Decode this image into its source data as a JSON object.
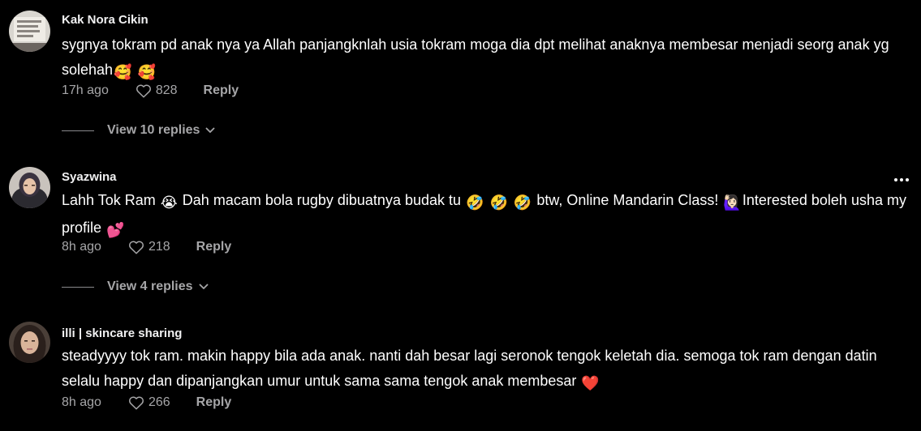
{
  "comments": [
    {
      "username": "Kak Nora Cikin",
      "text_parts": [
        "sygnya tokram pd anak nya ya Allah panjangknlah usia tokram moga dia dpt melihat anaknya membesar menjadi seorg anak yg solehah",
        "🥰",
        " ",
        "🥰"
      ],
      "time": "17h ago",
      "likes": "828",
      "reply_label": "Reply",
      "view_replies": "View 10 replies"
    },
    {
      "username": "Syazwina",
      "text_parts": [
        "Lahh Tok Ram ",
        "😭",
        " Dah macam bola rugby dibuatnya budak tu ",
        "🤣",
        " ",
        "🤣",
        " ",
        "🤣",
        " btw, Online Mandarin Class! ",
        "🙋🏻‍♀️",
        "Interested boleh usha my profile ",
        "💕"
      ],
      "time": "8h ago",
      "likes": "218",
      "reply_label": "Reply",
      "view_replies": "View 4 replies",
      "more_icon": "more-horizontal-icon"
    },
    {
      "username": "illi | skincare sharing",
      "text_parts": [
        "steadyyyy tok ram. makin happy bila ada anak. nanti dah besar lagi seronok tengok keletah dia. semoga tok ram dengan datin selalu happy dan dipanjangkan umur untuk sama sama tengok anak membesar ",
        "❤️"
      ],
      "time": "8h ago",
      "likes": "266",
      "reply_label": "Reply"
    }
  ],
  "icons": {
    "like": "heart-outline-icon",
    "expand": "chevron-down-icon"
  },
  "colors": {
    "background": "#000000",
    "text": "#ffffff",
    "muted": "#a6a6a8"
  }
}
